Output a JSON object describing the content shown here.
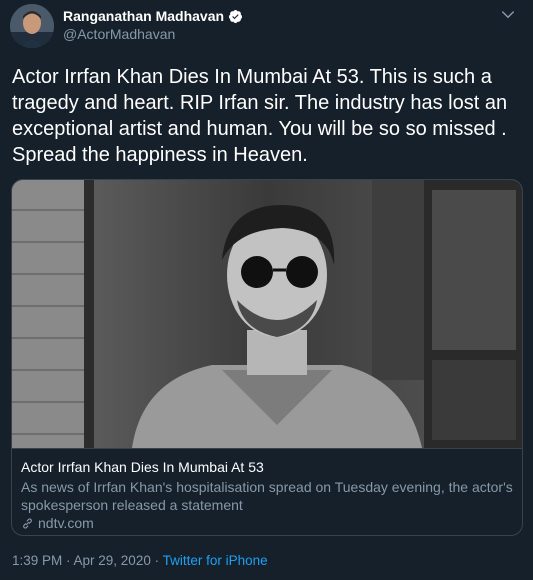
{
  "author": {
    "name": "Ranganathan Madhavan",
    "handle": "@ActorMadhavan",
    "verified": true
  },
  "tweet": {
    "text": "Actor Irrfan Khan Dies In Mumbai At 53. This is such a tragedy and heart. RIP Irfan sir. The industry has lost an exceptional artist and human. You will be so so missed . Spread the happiness in Heaven."
  },
  "card": {
    "title": "Actor Irrfan Khan Dies In Mumbai At 53",
    "description": "As news of Irrfan Khan's hospitalisation spread on Tuesday evening, the actor's spokesperson released a statement",
    "domain": "ndtv.com"
  },
  "meta": {
    "timestamp": "1:39 PM · Apr 29, 2020",
    "separator": " · ",
    "source": "Twitter for iPhone"
  },
  "colors": {
    "background": "#15202b",
    "secondary_text": "#8899a6",
    "link": "#1da1f2",
    "border": "#38444d"
  }
}
